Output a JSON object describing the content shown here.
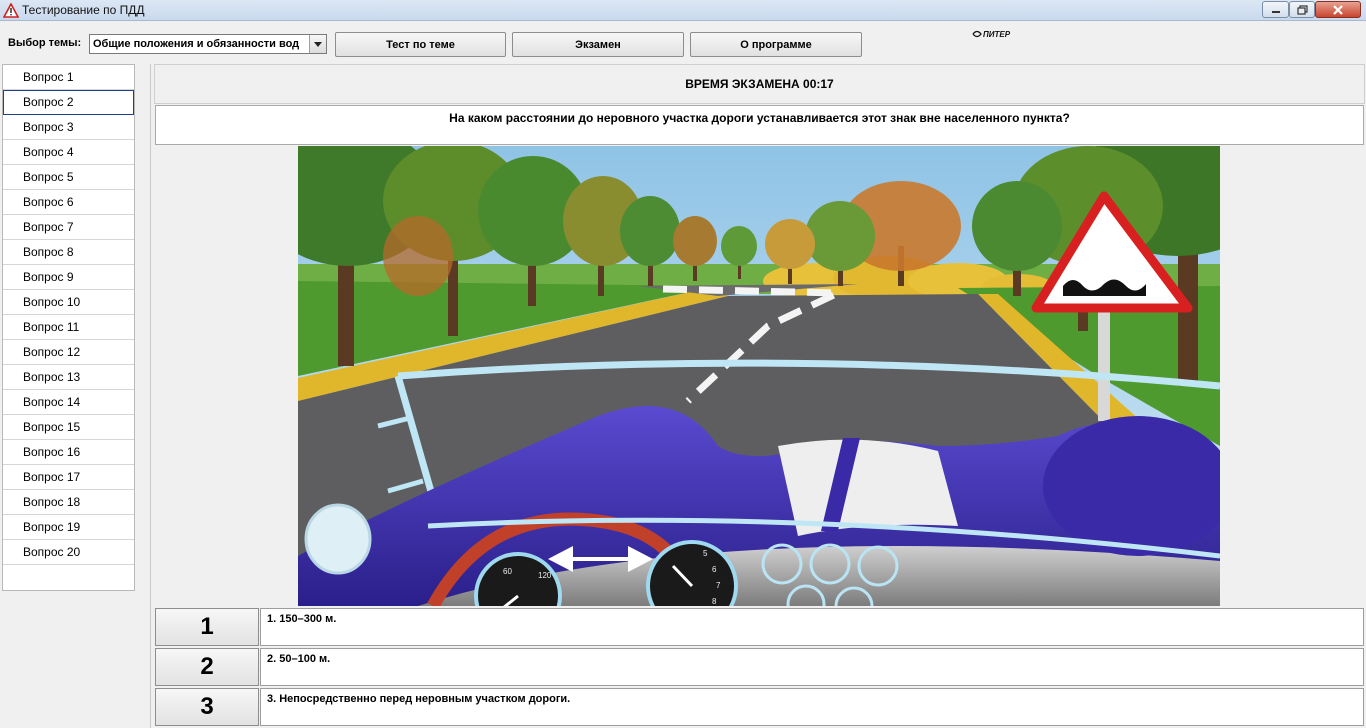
{
  "window": {
    "title": "Тестирование по ПДД"
  },
  "toolbar": {
    "topic_label": "Выбор темы:",
    "topic_value": "Общие положения и обязанности вод",
    "buttons": [
      "Тест по теме",
      "Экзамен",
      "О программе"
    ],
    "logo_text": "ПИТЕР"
  },
  "sidebar": {
    "items": [
      "Вопрос 1",
      "Вопрос 2",
      "Вопрос 3",
      "Вопрос 4",
      "Вопрос 5",
      "Вопрос 6",
      "Вопрос 7",
      "Вопрос 8",
      "Вопрос 9",
      "Вопрос 10",
      "Вопрос 11",
      "Вопрос 12",
      "Вопрос 13",
      "Вопрос 14",
      "Вопрос 15",
      "Вопрос 16",
      "Вопрос 17",
      "Вопрос 18",
      "Вопрос 19",
      "Вопрос 20"
    ],
    "selected_index": 1
  },
  "main": {
    "timer": "ВРЕМЯ ЭКЗАМЕНА 00:17",
    "question": "На каком расстоянии до неровного участка дороги устанавливается этот знак вне населенного пункта?",
    "answers": [
      {
        "number": "1",
        "text": "1. 150–300 м."
      },
      {
        "number": "2",
        "text": "2. 50–100 м."
      },
      {
        "number": "3",
        "text": "3. Непосредственно перед неровным участком дороги."
      }
    ]
  },
  "scene": {
    "description_icon": "road-sign-uneven-road-icon",
    "speedometer_ticks": [
      "60",
      "120"
    ],
    "tachometer_ticks": [
      "5",
      "6",
      "7",
      "8"
    ]
  },
  "colors": {
    "titlebar": "#c9d9ee",
    "car_body": "#3a2aa8",
    "sign_border": "#d82020",
    "grass": "#4f9a2e",
    "road": "#5e5e60"
  }
}
